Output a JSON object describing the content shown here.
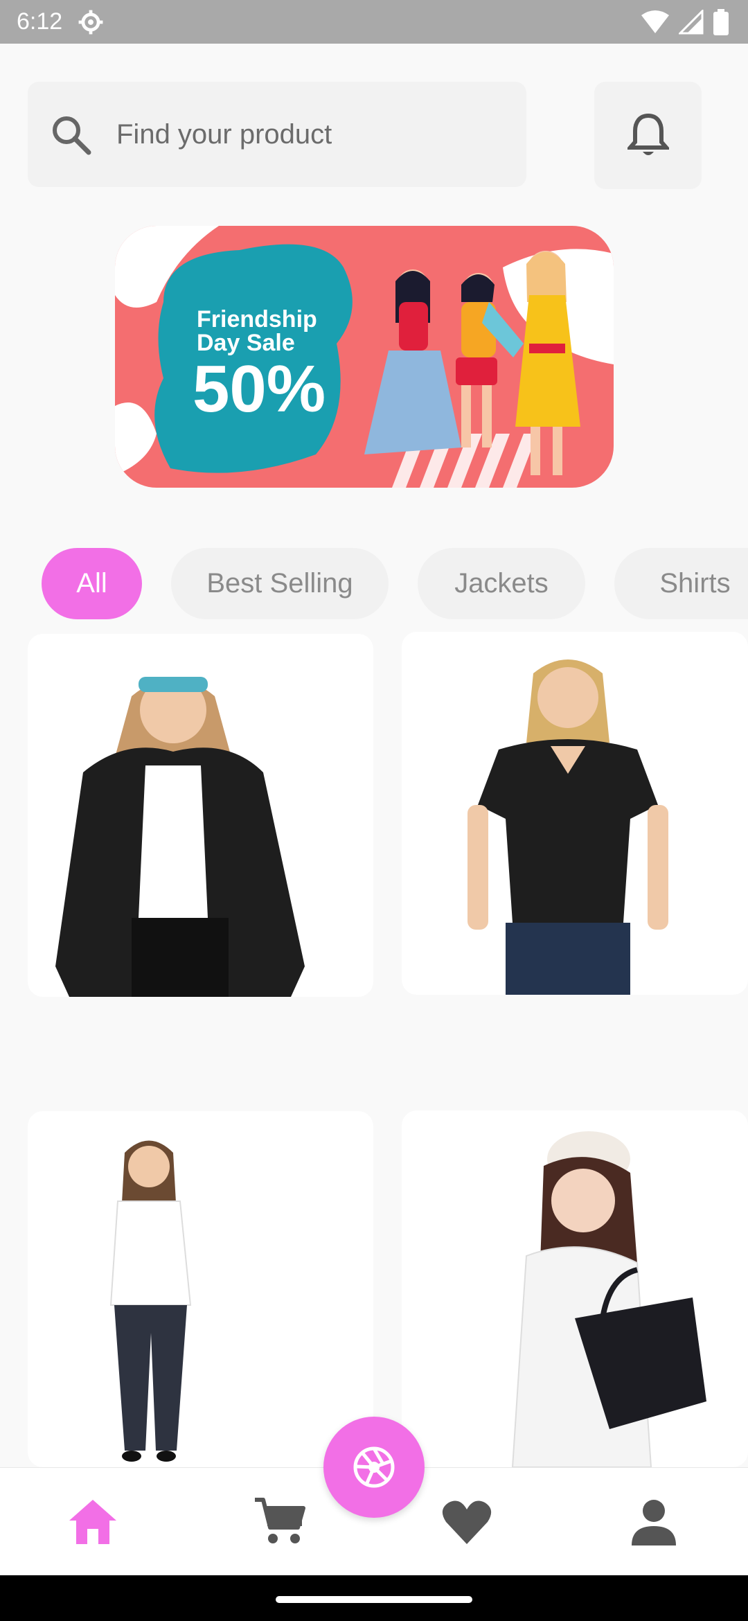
{
  "status": {
    "time": "6:12"
  },
  "search": {
    "placeholder": "Find your product"
  },
  "banner": {
    "line1": "Friendship",
    "line2": "Day Sale",
    "discount": "50%"
  },
  "tabs": [
    {
      "label": "All",
      "active": true
    },
    {
      "label": "Best Selling",
      "active": false
    },
    {
      "label": "Jackets",
      "active": false
    },
    {
      "label": "Shirts",
      "active": false
    }
  ],
  "products": [
    {
      "image": "woman-black-leather-jacket"
    },
    {
      "image": "woman-black-vneck-tshirt"
    },
    {
      "image": "woman-white-shirt-dark-pants"
    },
    {
      "image": "woman-lace-dress-black-handbag"
    }
  ],
  "bottom_nav": [
    {
      "icon": "home-icon",
      "active": true
    },
    {
      "icon": "cart-icon",
      "active": false
    },
    {
      "icon": "heart-icon",
      "active": false
    },
    {
      "icon": "person-icon",
      "active": false
    }
  ],
  "fab": {
    "icon": "aperture-icon"
  },
  "colors": {
    "accent": "#f26fe6",
    "banner": "#f46e70",
    "banner_blob": "#1a9fb0"
  }
}
